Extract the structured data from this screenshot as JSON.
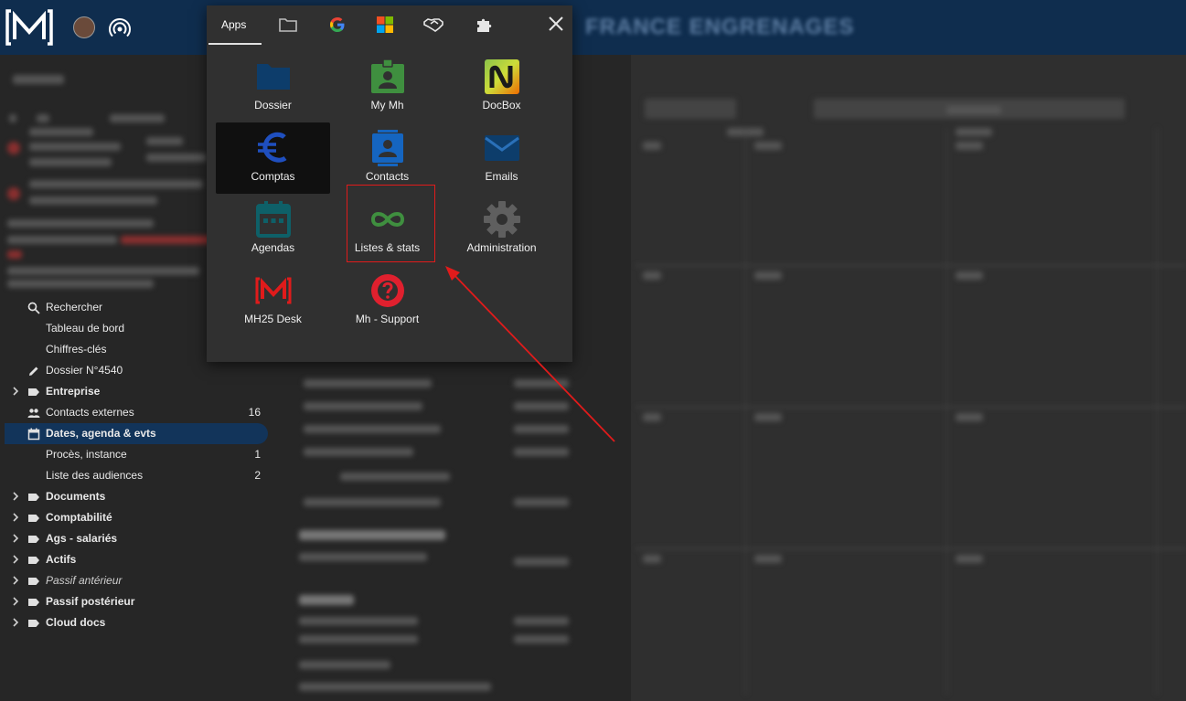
{
  "header": {
    "title": "FRANCE ENGRENAGES"
  },
  "sidebar": {
    "items": [
      {
        "label": "Rechercher",
        "icon": "search-icon",
        "chevron": false,
        "bold": false,
        "italic": false,
        "count": ""
      },
      {
        "label": "Tableau de bord",
        "icon": "",
        "chevron": false,
        "bold": false,
        "italic": false,
        "count": ""
      },
      {
        "label": "Chiffres-clés",
        "icon": "",
        "chevron": false,
        "bold": false,
        "italic": false,
        "count": ""
      },
      {
        "label": "Dossier N°4540",
        "icon": "pencil-icon",
        "chevron": false,
        "bold": false,
        "italic": false,
        "count": ""
      },
      {
        "label": "Entreprise",
        "icon": "label-icon",
        "chevron": true,
        "bold": true,
        "italic": false,
        "count": ""
      },
      {
        "label": "Contacts externes",
        "icon": "people-icon",
        "chevron": false,
        "bold": false,
        "italic": false,
        "count": "16"
      },
      {
        "label": "Dates, agenda & evts",
        "icon": "calendar-icon",
        "chevron": false,
        "bold": true,
        "italic": false,
        "count": "",
        "active": true
      },
      {
        "label": "Procès, instance",
        "icon": "",
        "chevron": false,
        "bold": false,
        "italic": false,
        "count": "1"
      },
      {
        "label": "Liste des audiences",
        "icon": "",
        "chevron": false,
        "bold": false,
        "italic": false,
        "count": "2"
      },
      {
        "label": "Documents",
        "icon": "label-icon",
        "chevron": true,
        "bold": true,
        "italic": false,
        "count": ""
      },
      {
        "label": "Comptabilité",
        "icon": "label-icon",
        "chevron": true,
        "bold": true,
        "italic": false,
        "count": ""
      },
      {
        "label": "Ags - salariés",
        "icon": "label-icon",
        "chevron": true,
        "bold": true,
        "italic": false,
        "count": ""
      },
      {
        "label": "Actifs",
        "icon": "label-icon",
        "chevron": true,
        "bold": true,
        "italic": false,
        "count": ""
      },
      {
        "label": "Passif antérieur",
        "icon": "label-icon",
        "chevron": true,
        "bold": false,
        "italic": true,
        "count": ""
      },
      {
        "label": "Passif postérieur",
        "icon": "label-icon",
        "chevron": true,
        "bold": true,
        "italic": false,
        "count": ""
      },
      {
        "label": "Cloud docs",
        "icon": "label-icon",
        "chevron": true,
        "bold": true,
        "italic": false,
        "count": ""
      }
    ]
  },
  "apps_popup": {
    "tabs": [
      {
        "label": "Apps",
        "icon": ""
      },
      {
        "label": "",
        "icon": "folder-icon"
      },
      {
        "label": "",
        "icon": "google-icon"
      },
      {
        "label": "",
        "icon": "microsoft-icon"
      },
      {
        "label": "",
        "icon": "handshake-icon"
      },
      {
        "label": "",
        "icon": "puzzle-icon"
      }
    ],
    "apps": [
      {
        "name": "Dossier",
        "icon": "folder-icon",
        "color": "#0d3d6b"
      },
      {
        "name": "My Mh",
        "icon": "badge-icon",
        "color": "#3f8f3f"
      },
      {
        "name": "DocBox",
        "icon": "docbox-icon",
        "color": "#e8620e"
      },
      {
        "name": "Comptas",
        "icon": "euro-icon",
        "color": "#1f4fbf",
        "selected": true
      },
      {
        "name": "Contacts",
        "icon": "contact-card-icon",
        "color": "#1565c0"
      },
      {
        "name": "Emails",
        "icon": "mail-icon",
        "color": "#0d3d6b"
      },
      {
        "name": "Agendas",
        "icon": "calendar-icon",
        "color": "#0e6068"
      },
      {
        "name": "Listes & stats",
        "icon": "infinity-icon",
        "color": "#3f8f3f"
      },
      {
        "name": "Administration",
        "icon": "gear-icon",
        "color": "#5f5f5f"
      },
      {
        "name": "MH25 Desk",
        "icon": "mh-logo-icon",
        "color": "#e01b1b"
      },
      {
        "name": "Mh - Support",
        "icon": "help-icon",
        "color": "#e0202e"
      }
    ]
  },
  "colors": {
    "accent": "#0f2d4e",
    "highlight": "#e01b1b"
  }
}
